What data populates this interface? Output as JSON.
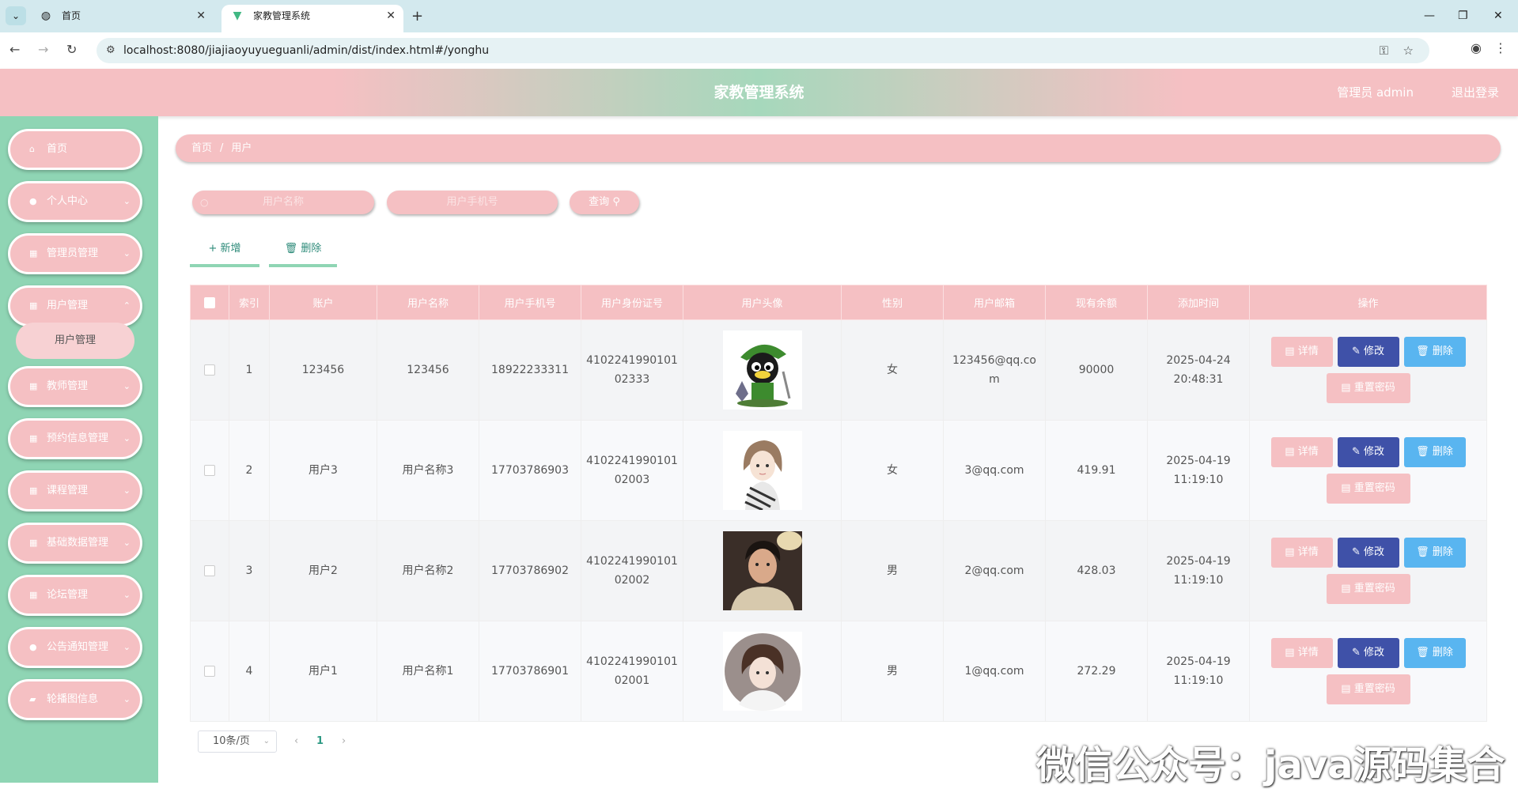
{
  "browser": {
    "tabs": [
      {
        "title": "首页",
        "icon": "globe-icon"
      },
      {
        "title": "家教管理系统",
        "icon": "vue-logo-icon"
      }
    ],
    "url": "localhost:8080/jiajiaoyuyueguanli/admin/dist/index.html#/yonghu"
  },
  "header": {
    "title": "家教管理系统",
    "admin_label": "管理员 admin",
    "logout_label": "退出登录"
  },
  "sidebar": {
    "items": [
      {
        "label": "首页",
        "icon": "home-icon"
      },
      {
        "label": "个人中心",
        "icon": "user-icon"
      },
      {
        "label": "管理员管理",
        "icon": "grid-icon"
      },
      {
        "label": "用户管理",
        "icon": "grid-icon"
      },
      {
        "label": "教师管理",
        "icon": "grid-icon"
      },
      {
        "label": "预约信息管理",
        "icon": "grid-icon"
      },
      {
        "label": "课程管理",
        "icon": "grid-icon"
      },
      {
        "label": "基础数据管理",
        "icon": "grid-icon"
      },
      {
        "label": "论坛管理",
        "icon": "grid-icon"
      },
      {
        "label": "公告通知管理",
        "icon": "user-icon"
      },
      {
        "label": "轮播图信息",
        "icon": "ticket-icon"
      }
    ],
    "active_sub": "用户管理"
  },
  "breadcrumb": {
    "home": "首页",
    "sep": "/",
    "current": "用户"
  },
  "search": {
    "name_placeholder": "用户名称",
    "field2_placeholder": "用户手机号",
    "query_label": "查询"
  },
  "actions": {
    "add_label": "新增",
    "delete_label": "删除"
  },
  "table": {
    "headers": [
      "索引",
      "账户",
      "用户名称",
      "用户手机号",
      "用户身份证号",
      "用户头像",
      "性别",
      "用户邮箱",
      "现有余额",
      "添加时间",
      "操作"
    ],
    "rows": [
      {
        "index": "1",
        "account": "123456",
        "name": "123456",
        "phone": "18922233311",
        "id_card": "410224199010102333",
        "gender": "女",
        "email": "123456@qq.com",
        "balance": "90000",
        "added": "2025-04-24 20:48:31",
        "avatar": "cartoon-character-avatar"
      },
      {
        "index": "2",
        "account": "用户3",
        "name": "用户名称3",
        "phone": "17703786903",
        "id_card": "410224199010102003",
        "gender": "女",
        "email": "3@qq.com",
        "balance": "419.91",
        "added": "2025-04-19 11:19:10",
        "avatar": "girl-sketch-avatar"
      },
      {
        "index": "3",
        "account": "用户2",
        "name": "用户名称2",
        "phone": "17703786902",
        "id_card": "410224199010102002",
        "gender": "男",
        "email": "2@qq.com",
        "balance": "428.03",
        "added": "2025-04-19 11:19:10",
        "avatar": "boy-photo-avatar"
      },
      {
        "index": "4",
        "account": "用户1",
        "name": "用户名称1",
        "phone": "17703786901",
        "id_card": "410224199010102001",
        "gender": "男",
        "email": "1@qq.com",
        "balance": "272.29",
        "added": "2025-04-19 11:19:10",
        "avatar": "girl-round-avatar"
      }
    ],
    "row_buttons": {
      "detail": "详情",
      "edit": "修改",
      "delete": "删除",
      "reset_pwd": "重置密码"
    }
  },
  "pagination": {
    "page_size": "10条/页",
    "current_page": "1",
    "prev": "‹",
    "next": "›"
  },
  "watermark": "微信公众号：java源码集合",
  "colors": {
    "pink": "#f5c0c3",
    "green": "#8fd5b4",
    "edit_blue": "#3f51a8",
    "delete_blue": "#59b5f0"
  }
}
